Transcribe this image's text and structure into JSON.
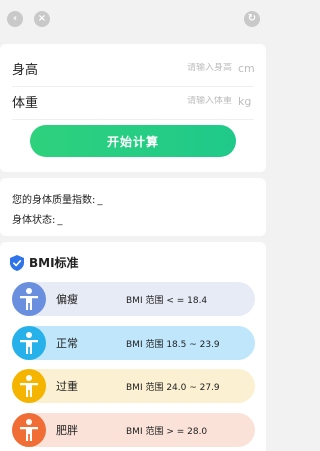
{
  "colors": {
    "accent_green": "#22cc85",
    "underweight_bg": "#e6ebf5",
    "underweight_icon": "#6a8fdf",
    "normal_bg": "#bfe6fb",
    "normal_icon": "#26b1ea",
    "overweight_bg": "#fbf0d2",
    "overweight_icon": "#f5b400",
    "obese_bg": "#fbe2d8",
    "obese_icon": "#f06d36"
  },
  "topbar": {
    "back_icon": "chevron-left-icon",
    "close_icon": "close-icon",
    "refresh_icon": "refresh-icon"
  },
  "form": {
    "height": {
      "label": "身高",
      "placeholder": "请输入身高",
      "unit": "cm",
      "value": ""
    },
    "weight": {
      "label": "体重",
      "placeholder": "请输入体重",
      "unit": "kg",
      "value": ""
    },
    "calc_button": "开始计算"
  },
  "result": {
    "bmi_label": "您的身体质量指数:",
    "bmi_value": "_",
    "status_label": "身体状态:",
    "status_value": "_"
  },
  "standard": {
    "title": "BMI标准",
    "items": [
      {
        "name": "偏瘦",
        "range": "BMI 范围 < = 18.4"
      },
      {
        "name": "正常",
        "range": "BMI 范围 18.5 ~ 23.9"
      },
      {
        "name": "过重",
        "range": "BMI 范围 24.0 ~ 27.9"
      },
      {
        "name": "肥胖",
        "range": "BMI 范围 > = 28.0"
      }
    ]
  }
}
